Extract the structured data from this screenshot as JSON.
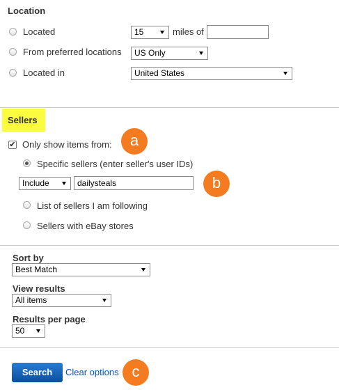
{
  "location": {
    "title": "Location",
    "located_label": "Located",
    "miles_value": "15",
    "miles_of_label": "miles of",
    "zip_value": "",
    "preferred_label": "From preferred locations",
    "preferred_value": "US Only",
    "located_in_label": "Located in",
    "located_in_value": "United States"
  },
  "sellers": {
    "title": "Sellers",
    "only_show_label": "Only show items from:",
    "only_show_checked": true,
    "specific_label": "Specific sellers (enter seller's user IDs)",
    "include_value": "Include",
    "sellers_value": "dailysteals",
    "following_label": "List of sellers I am following",
    "stores_label": "Sellers with eBay stores",
    "highlight_color": "#fbfb3f"
  },
  "sort": {
    "sort_by_label": "Sort by",
    "sort_by_value": "Best Match",
    "view_results_label": "View results",
    "view_results_value": "All items",
    "per_page_label": "Results per page",
    "per_page_value": "50"
  },
  "actions": {
    "search_label": "Search",
    "clear_label": "Clear options"
  },
  "callouts": {
    "a": "a",
    "b": "b",
    "c": "c",
    "color": "#f47b20"
  }
}
